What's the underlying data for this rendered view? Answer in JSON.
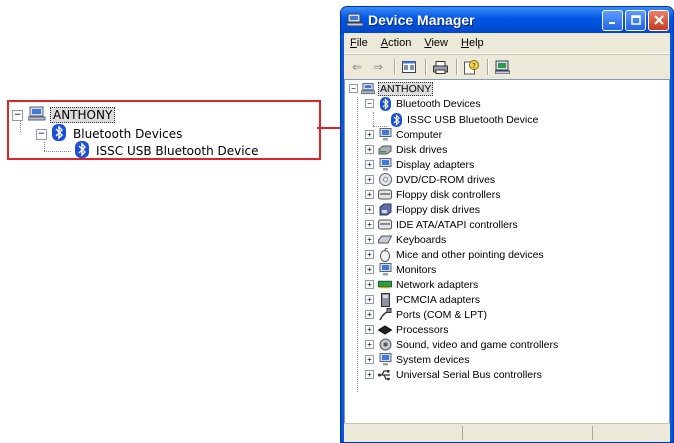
{
  "callout": {
    "root_label": "ANTHONY",
    "category_label": "Bluetooth Devices",
    "device_label": "ISSC USB Bluetooth Device"
  },
  "window": {
    "title": "Device Manager",
    "menu": [
      "File",
      "Action",
      "View",
      "Help"
    ],
    "toolbar_icons": [
      "back-arrow-icon",
      "forward-arrow-icon",
      "properties-icon",
      "print-icon",
      "help-icon",
      "scan-hardware-icon"
    ]
  },
  "tree": {
    "root": "ANTHONY",
    "items": [
      {
        "label": "Bluetooth Devices",
        "icon": "bluetooth-icon",
        "expanded": true,
        "children": [
          {
            "label": "ISSC USB Bluetooth Device",
            "icon": "bluetooth-icon"
          }
        ]
      },
      {
        "label": "Computer",
        "icon": "computer-icon"
      },
      {
        "label": "Disk drives",
        "icon": "disk-drive-icon"
      },
      {
        "label": "Display adapters",
        "icon": "display-adapter-icon"
      },
      {
        "label": "DVD/CD-ROM drives",
        "icon": "cdrom-icon"
      },
      {
        "label": "Floppy disk controllers",
        "icon": "controller-icon"
      },
      {
        "label": "Floppy disk drives",
        "icon": "floppy-icon"
      },
      {
        "label": "IDE ATA/ATAPI controllers",
        "icon": "controller-icon"
      },
      {
        "label": "Keyboards",
        "icon": "keyboard-icon"
      },
      {
        "label": "Mice and other pointing devices",
        "icon": "mouse-icon"
      },
      {
        "label": "Monitors",
        "icon": "monitor-icon"
      },
      {
        "label": "Network adapters",
        "icon": "network-adapter-icon"
      },
      {
        "label": "PCMCIA adapters",
        "icon": "pcmcia-icon"
      },
      {
        "label": "Ports (COM & LPT)",
        "icon": "port-icon"
      },
      {
        "label": "Processors",
        "icon": "processor-icon"
      },
      {
        "label": "Sound, video and game controllers",
        "icon": "sound-icon"
      },
      {
        "label": "System devices",
        "icon": "system-icon"
      },
      {
        "label": "Universal Serial Bus controllers",
        "icon": "usb-icon"
      }
    ]
  },
  "colors": {
    "callout_border": "#d9262b",
    "xp_title": "#0055e5",
    "bluetooth": "#1b4fd8"
  }
}
